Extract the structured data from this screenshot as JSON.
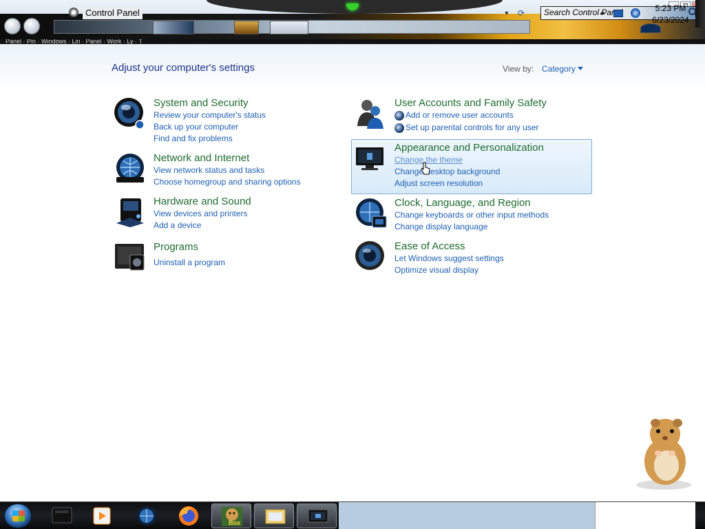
{
  "window": {
    "controls": [
      "_",
      "❐",
      "✕"
    ]
  },
  "address": {
    "path": "Control Panel",
    "nav_strip_text": "Panel · Pin · Windows · Lin · Panel · Work · Ly · T"
  },
  "search": {
    "placeholder": "Search Control Panel"
  },
  "header": {
    "title": "Adjust your computer's settings",
    "view_by_label": "View by:",
    "view_by_value": "Category"
  },
  "categories": {
    "system": {
      "title": "System and Security",
      "links": [
        "Review your computer's status",
        "Back up your computer",
        "Find and fix problems"
      ]
    },
    "network": {
      "title": "Network and Internet",
      "links": [
        "View network status and tasks",
        "Choose homegroup and sharing options"
      ]
    },
    "hardware": {
      "title": "Hardware and Sound",
      "links": [
        "View devices and printers",
        "Add a device"
      ]
    },
    "programs": {
      "title": "Programs",
      "links": [
        "Uninstall a program"
      ]
    },
    "users": {
      "title": "User Accounts and Family Safety",
      "links": [
        "Add or remove user accounts",
        "Set up parental controls for any user"
      ]
    },
    "appearance": {
      "title": "Appearance and Personalization",
      "links": [
        "Change the theme",
        "Change desktop background",
        "Adjust screen resolution"
      ]
    },
    "clock": {
      "title": "Clock, Language, and Region",
      "links": [
        "Change keyboards or other input methods",
        "Change display language"
      ]
    },
    "ease": {
      "title": "Ease of Access",
      "links": [
        "Let Windows suggest settings",
        "Optimize visual display"
      ]
    }
  },
  "taskbar": {
    "items": [
      "windows-explorer-icon",
      "media-player-icon",
      "globe-icon",
      "firefox-icon",
      "hamster-box-icon",
      "explorer-folder-icon",
      "control-panel-icon"
    ],
    "hamster_badge": "Box"
  },
  "tray": {
    "time": "5:23 PM",
    "date": "6/23/2024"
  },
  "colors": {
    "link": "#1e5fb4",
    "category_title": "#1e6b2e",
    "page_title": "#1e3287",
    "highlight_border": "#84acd6"
  }
}
